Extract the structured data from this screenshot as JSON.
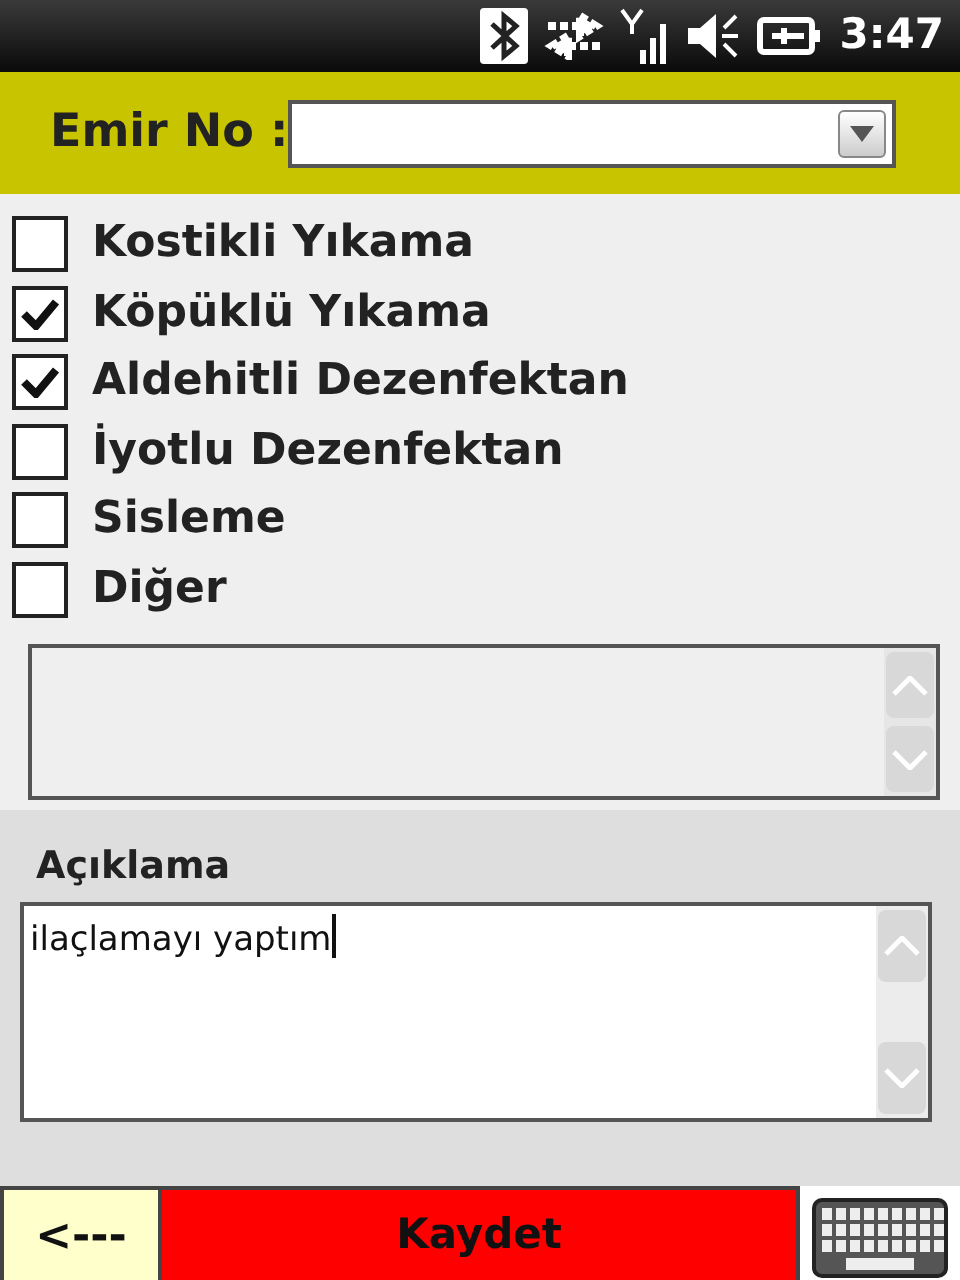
{
  "status_bar": {
    "time": "3:47"
  },
  "header": {
    "label": "Emir No :"
  },
  "options": [
    {
      "label": "Kostikli Yıkama",
      "checked": false
    },
    {
      "label": "Köpüklü Yıkama",
      "checked": true
    },
    {
      "label": "Aldehitli Dezenfektan",
      "checked": true
    },
    {
      "label": "İyotlu Dezenfektan",
      "checked": false
    },
    {
      "label": "Sisleme",
      "checked": false
    },
    {
      "label": "Diğer",
      "checked": false
    }
  ],
  "description": {
    "label": "Açıklama",
    "value": "ilaçlamayı yaptım"
  },
  "buttons": {
    "back": "<---",
    "save": "Kaydet"
  }
}
